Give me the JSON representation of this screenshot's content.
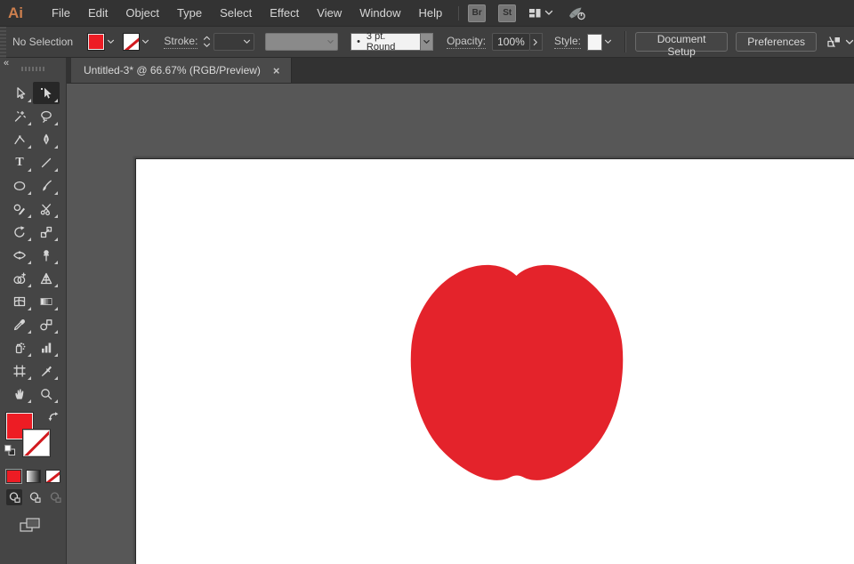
{
  "menu_bar": {
    "logo": "Ai",
    "items": [
      "File",
      "Edit",
      "Object",
      "Type",
      "Select",
      "Effect",
      "View",
      "Window",
      "Help"
    ],
    "bridge_button": "Br",
    "stock_button": "St",
    "icons": [
      "workspace-switcher-icon",
      "chevron-down-icon",
      "gpu-performance-icon"
    ]
  },
  "control_bar": {
    "selection_status": "No Selection",
    "fill_swatch_color": "#ED1C24",
    "stroke_swatch": "none",
    "stroke_label": "Stroke:",
    "brush_bullet": "•",
    "brush_preset": "3 pt. Round",
    "opacity_label": "Opacity:",
    "opacity_value": "100%",
    "style_label": "Style:",
    "document_setup_button": "Document Setup",
    "preferences_button": "Preferences"
  },
  "document_tab": {
    "title": "Untitled-3* @ 66.67% (RGB/Preview)",
    "close_glyph": "×"
  },
  "toolbar": {
    "collapse_glyph": "«",
    "type_tool_glyph": "T",
    "tools": [
      "selection-tool",
      "direct-selection-tool",
      "magic-wand-tool",
      "lasso-tool",
      "curvature-tool",
      "pen-tool",
      "type-tool",
      "line-segment-tool",
      "ellipse-tool",
      "paintbrush-tool",
      "shaper-tool",
      "scissors-tool",
      "rotate-tool",
      "scale-tool",
      "width-tool",
      "puppet-warp-tool",
      "shape-builder-tool",
      "perspective-grid-tool",
      "mesh-tool",
      "gradient-tool",
      "eyedropper-tool",
      "blend-tool",
      "symbol-sprayer-tool",
      "column-graph-tool",
      "artboard-tool",
      "slice-tool",
      "hand-tool",
      "zoom-tool"
    ],
    "selected_tool": "direct-selection-tool",
    "fill_color": "#ED1C24",
    "stroke_color": "none",
    "drawing_modes": [
      "draw-normal",
      "draw-behind",
      "draw-inside"
    ],
    "selected_drawing_mode": "draw-normal"
  },
  "canvas": {
    "artboard_color": "#FFFFFF",
    "background_color": "#575757",
    "shape": {
      "type": "apple",
      "fill": "#E4232B"
    }
  },
  "colors": {
    "menubar": "#333333",
    "controlbar": "#3F3F3F",
    "tab_active": "#4A4A4A",
    "toolbar": "#454545",
    "logo_accent": "#CD7F4E",
    "swatch_red": "#ED1C24"
  }
}
